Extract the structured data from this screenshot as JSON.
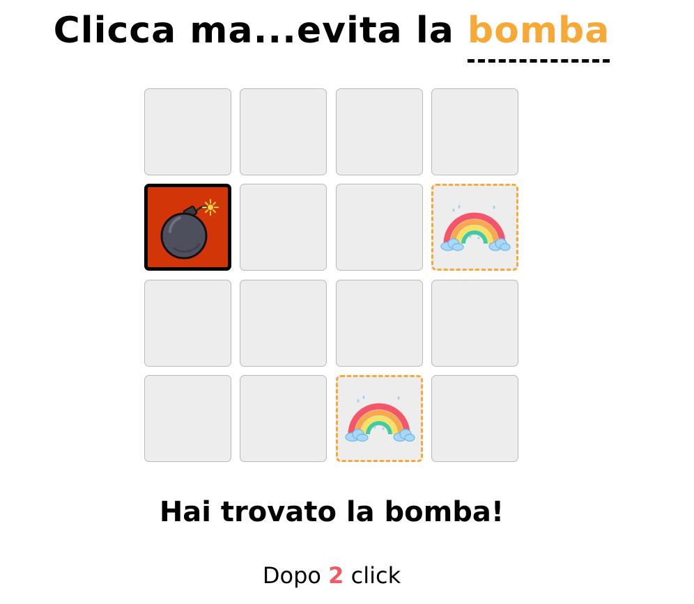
{
  "title": {
    "prefix": "Clicca ma...evita la",
    "accent": "bomba",
    "accent_color": "#f6a937"
  },
  "grid": {
    "rows": 4,
    "cols": 4,
    "cells": [
      [
        "hidden",
        "hidden",
        "hidden",
        "hidden"
      ],
      [
        "bomb",
        "hidden",
        "hidden",
        "safe"
      ],
      [
        "hidden",
        "hidden",
        "hidden",
        "hidden"
      ],
      [
        "hidden",
        "hidden",
        "safe",
        "hidden"
      ]
    ],
    "icons": {
      "bomb": "bomb-icon",
      "safe": "rainbow-icon"
    },
    "colors": {
      "hidden_bg": "#ededed",
      "safe_border": "#f6a937",
      "bomb_bg": "#d13508"
    }
  },
  "result": {
    "message": "Hai trovato la bomba!",
    "clicks_prefix": "Dopo",
    "clicks_count": "2",
    "clicks_suffix": "click",
    "count_color": "#ef5a66"
  }
}
